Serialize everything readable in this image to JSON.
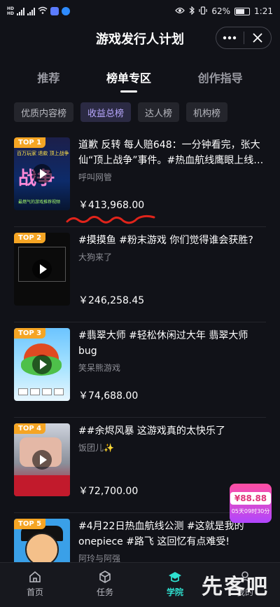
{
  "status_bar": {
    "time": "1:21",
    "battery": "62%"
  },
  "header": {
    "title": "游戏发行人计划",
    "more_icon": "more-dots-icon",
    "close_icon": "close-icon"
  },
  "tabs": [
    {
      "label": "推荐",
      "active": false
    },
    {
      "label": "榜单专区",
      "active": true
    },
    {
      "label": "创作指导",
      "active": false
    }
  ],
  "chips": [
    {
      "label": "优质内容榜",
      "active": false
    },
    {
      "label": "收益总榜",
      "active": true
    },
    {
      "label": "达人榜",
      "active": false
    },
    {
      "label": "机构榜",
      "active": false
    }
  ],
  "items": [
    {
      "rank": "TOP 1",
      "title": "道歉 反转 每人赔648：一分钟看完，张大仙“顶上战争”事件。#热血航线鹰眼上线…",
      "author": "呼叫网管",
      "amount": "￥413,968.00",
      "thumb_text": "战争",
      "thumb_line1": "百万玩家 退款 顶上战争",
      "thumb_footer": "最燃气的游戏推荐视频"
    },
    {
      "rank": "TOP 2",
      "title": "#摸摸鱼 #粉末游戏 你们觉得谁会获胜?",
      "author": "大狗来了",
      "amount": "￥246,258.45"
    },
    {
      "rank": "TOP 3",
      "title": "#翡翠大师 #轻松休闲过大年 翡翠大师bug",
      "author": "笑呆熊游戏",
      "amount": "￥74,688.00"
    },
    {
      "rank": "TOP 4",
      "title": "##余烬风暴 这游戏真的太快乐了",
      "author": "饭团儿✨",
      "amount": "￥72,700.00"
    },
    {
      "rank": "TOP 5",
      "title": "#4月22日热血航线公测 #这就是我的onepiece #路飞 这回忆有点难受!",
      "author": "阿玲与阿强",
      "amount": ""
    }
  ],
  "float_badge": {
    "price": "¥88.88",
    "countdown": "05天09时30分"
  },
  "bottom_nav": [
    {
      "label": "首页",
      "icon": "home-icon",
      "active": false
    },
    {
      "label": "任务",
      "icon": "cube-icon",
      "active": false
    },
    {
      "label": "学院",
      "icon": "graduation-cap-icon",
      "active": true
    },
    {
      "label": "我的",
      "icon": "user-icon",
      "active": false
    }
  ],
  "watermark": "先客吧",
  "colors": {
    "background": "#111218",
    "accent_teal": "#2fe0d0",
    "chip_active_text": "#b8a8ff",
    "rank_badge": "#f5a524",
    "annotation_red": "#e0241b"
  }
}
